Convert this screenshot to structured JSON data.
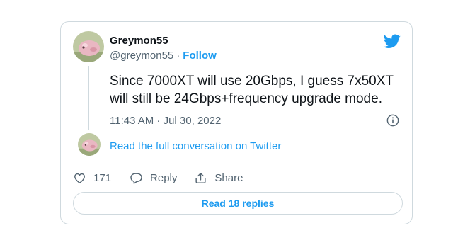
{
  "author": {
    "name": "Greymon55",
    "handle": "@greymon55",
    "separator": "·",
    "follow_label": "Follow"
  },
  "tweet": {
    "text": "Since 7000XT will use 20Gbps, I guess 7x50XT will still be 24Gbps+frequency upgrade mode.",
    "timestamp": "11:43 AM · Jul 30, 2022"
  },
  "conversation": {
    "link_label": "Read the full conversation on Twitter"
  },
  "actions": {
    "like_count": "171",
    "reply_label": "Reply",
    "share_label": "Share"
  },
  "read_replies_label": "Read 18 replies",
  "icons": {
    "brand": "twitter-bird-icon",
    "info": "info-icon",
    "like": "heart-icon",
    "reply": "reply-icon",
    "share": "share-icon"
  },
  "colors": {
    "accent": "#1d9bf0",
    "text": "#0f1419",
    "secondary": "#536471",
    "border": "#cfd9de"
  }
}
